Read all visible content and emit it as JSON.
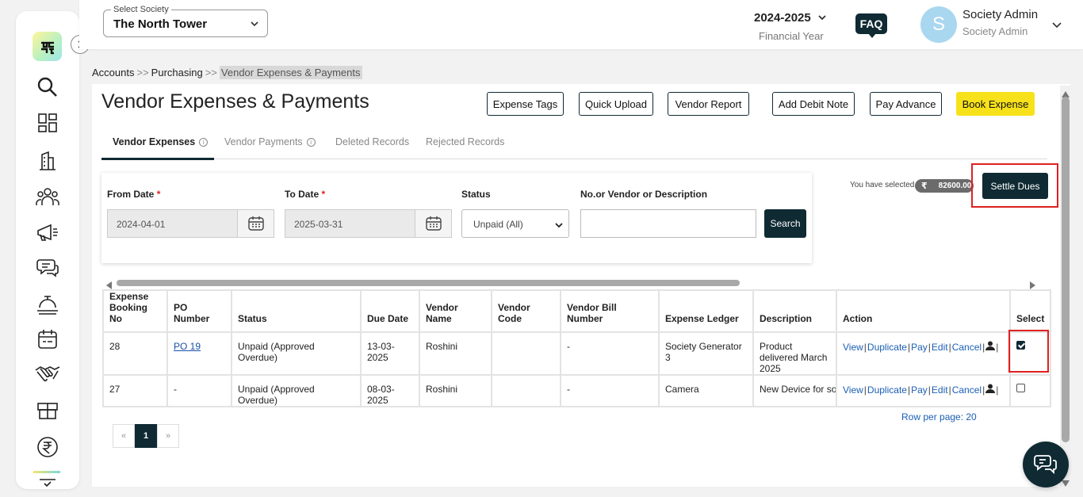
{
  "header": {
    "society_legend": "Select Society",
    "society_value": "The North Tower",
    "financial_year": "2024-2025",
    "financial_year_label": "Financial Year",
    "faq": "FAQ",
    "avatar_letter": "S",
    "user_name": "Society Admin",
    "user_role": "Society Admin"
  },
  "breadcrumb": {
    "item1": "Accounts",
    "item2": "Purchasing",
    "item3": "Vendor Expenses & Payments",
    "separator": ">>"
  },
  "page": {
    "title": "Vendor Expenses & Payments"
  },
  "toolbar": {
    "expense_tags": "Expense Tags",
    "quick_upload": "Quick Upload",
    "vendor_report": "Vendor Report",
    "add_debit_note": "Add Debit Note",
    "pay_advance": "Pay Advance",
    "book_expense": "Book Expense"
  },
  "tabs": {
    "vendor_expenses": "Vendor Expenses",
    "vendor_payments": "Vendor Payments",
    "deleted_records": "Deleted Records",
    "rejected_records": "Rejected Records",
    "info_glyph": "i"
  },
  "filters": {
    "from_date_label": "From Date",
    "from_date_value": "2024-04-01",
    "to_date_label": "To Date",
    "to_date_value": "2025-03-31",
    "required_mark": "*",
    "status_label": "Status",
    "status_value": "Unpaid (All)",
    "search_label": "No.or Vendor or Description",
    "search_value": "",
    "search_button": "Search"
  },
  "selection": {
    "text": "You have selected",
    "currency": "₹",
    "amount": "82600.00",
    "settle_button": "Settle Dues"
  },
  "table": {
    "headers": {
      "booking_no": "Expense Booking No",
      "po_number": "PO Number",
      "status": "Status",
      "due_date": "Due Date",
      "vendor_name": "Vendor Name",
      "vendor_code": "Vendor Code",
      "vendor_bill": "Vendor Bill Number",
      "expense_ledger": "Expense Ledger",
      "description": "Description",
      "action": "Action",
      "select": "Select"
    },
    "actions": {
      "view": "View",
      "duplicate": "Duplicate",
      "pay": "Pay",
      "edit": "Edit",
      "cancel": "Cancel",
      "sep": "|"
    },
    "rows": [
      {
        "booking_no": "28",
        "po_number": "PO 19",
        "status": "Unpaid (Approved Overdue)",
        "due_date": "13-03-2025",
        "vendor_name": "Roshini",
        "vendor_code": "",
        "vendor_bill": "-",
        "expense_ledger": "Society Generator 3",
        "description": "Product delivered March 2025",
        "selected": true
      },
      {
        "booking_no": "27",
        "po_number": "-",
        "status": "Unpaid (Approved Overdue)",
        "due_date": "08-03-2025",
        "vendor_name": "Roshini",
        "vendor_code": "",
        "vendor_bill": "-",
        "expense_ledger": "Camera",
        "description": "New Device for soc",
        "selected": false
      }
    ]
  },
  "pagination": {
    "prev": "«",
    "current": "1",
    "next": "»",
    "rows_per_page": "Row per page: 20"
  },
  "sidebar": {
    "icons": [
      "app-logo-icon",
      "search-icon",
      "dashboard-icon",
      "building-icon",
      "members-icon",
      "announcement-icon",
      "chat-icon",
      "facility-icon",
      "calendar-icon",
      "handshake-icon",
      "package-icon",
      "rupee-icon",
      "checklist-icon"
    ]
  },
  "colors": {
    "primary": "#0f2a33",
    "accent_yellow": "#f7e11a",
    "highlight_red": "#e02020",
    "link_blue": "#1a5fb4"
  }
}
